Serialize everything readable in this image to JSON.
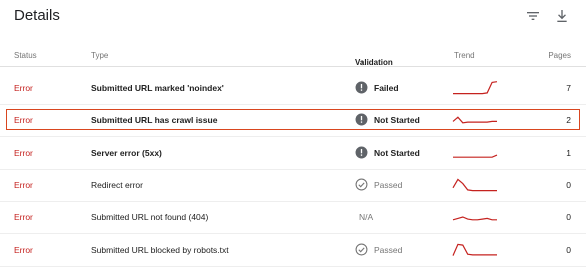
{
  "header": {
    "title": "Details",
    "filter_icon": "filter-list-icon",
    "download_icon": "download-icon"
  },
  "columns": {
    "status": "Status",
    "type": "Type",
    "validation": "Validation",
    "sort_icon": "arrow-upward-icon",
    "trend": "Trend",
    "pages": "Pages"
  },
  "colors": {
    "error": "#c5221f",
    "trend_line": "#c5221f",
    "highlight_border": "#d9461f"
  },
  "rows": [
    {
      "status": "Error",
      "type": "Submitted URL marked 'noindex'",
      "validation": "Failed",
      "validation_icon": "exclamation-circle-icon",
      "trend": [
        0.1,
        0.1,
        0.1,
        0.1,
        0.1,
        0.1,
        0.1,
        0.15,
        0.9,
        0.95
      ],
      "pages": "7"
    },
    {
      "status": "Error",
      "type": "Submitted URL has crawl issue",
      "validation": "Not Started",
      "validation_icon": "exclamation-circle-icon",
      "trend": [
        0.4,
        0.7,
        0.3,
        0.35,
        0.35,
        0.35,
        0.35,
        0.35,
        0.4,
        0.4
      ],
      "pages": "2",
      "highlighted": true
    },
    {
      "status": "Error",
      "type": "Server error (5xx)",
      "validation": "Not Started",
      "validation_icon": "exclamation-circle-icon",
      "trend": [
        0.2,
        0.2,
        0.2,
        0.2,
        0.2,
        0.2,
        0.2,
        0.2,
        0.2,
        0.35
      ],
      "pages": "1"
    },
    {
      "status": "Error",
      "type": "Redirect error",
      "validation": "Passed",
      "validation_icon": "check-circle-icon",
      "trend": [
        0.3,
        0.9,
        0.6,
        0.15,
        0.1,
        0.1,
        0.1,
        0.1,
        0.1,
        0.1
      ],
      "pages": "0"
    },
    {
      "status": "Error",
      "type": "Submitted URL not found (404)",
      "validation": "N/A",
      "validation_icon": "",
      "trend": [
        0.3,
        0.4,
        0.5,
        0.35,
        0.3,
        0.3,
        0.35,
        0.4,
        0.3,
        0.3
      ],
      "pages": "0"
    },
    {
      "status": "Error",
      "type": "Submitted URL blocked by robots.txt",
      "validation": "Passed",
      "validation_icon": "check-circle-icon",
      "trend": [
        0.1,
        0.9,
        0.85,
        0.2,
        0.15,
        0.15,
        0.15,
        0.15,
        0.15,
        0.15
      ],
      "pages": "0"
    }
  ]
}
